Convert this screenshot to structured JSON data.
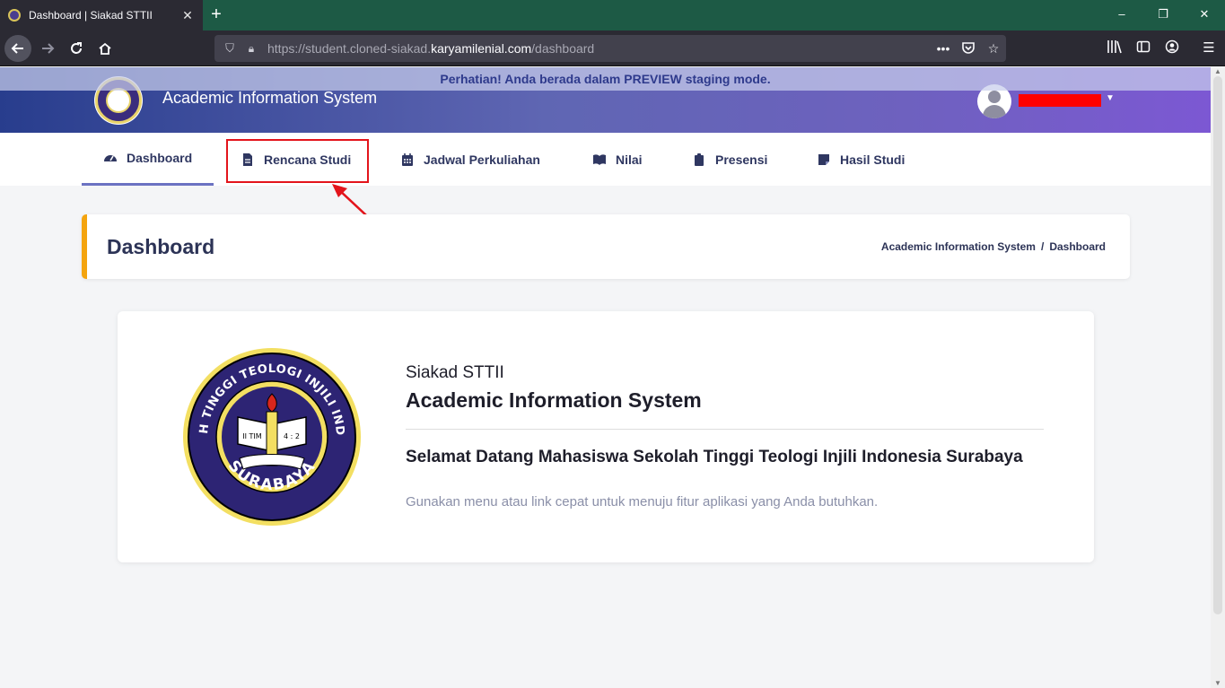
{
  "browser": {
    "tab_title": "Dashboard | Siakad STTII",
    "tab_close": "✕",
    "new_tab": "+",
    "url_prefix": "https://student.cloned-siakad.",
    "url_domain": "karyamilenial.com",
    "url_path": "/dashboard",
    "window_controls": {
      "minimize": "–",
      "restore": "❐",
      "close": "✕"
    }
  },
  "page": {
    "preview_notice": "Perhatian! Anda berada dalam PREVIEW staging mode.",
    "app_title": "Academic Information System",
    "menu": [
      {
        "label": "Dashboard",
        "icon": "dashboard-gauge-icon"
      },
      {
        "label": "Rencana Studi",
        "icon": "document-icon"
      },
      {
        "label": "Jadwal Perkuliahan",
        "icon": "calendar-icon"
      },
      {
        "label": "Nilai",
        "icon": "book-icon"
      },
      {
        "label": "Presensi",
        "icon": "clipboard-icon"
      },
      {
        "label": "Hasil Studi",
        "icon": "note-icon"
      }
    ],
    "page_title": "Dashboard",
    "breadcrumb": {
      "root": "Academic Information System",
      "sep": "/",
      "current": "Dashboard"
    },
    "card": {
      "subtitle": "Siakad STTII",
      "heading": "Academic Information System",
      "welcome": "Selamat Datang Mahasiswa Sekolah Tinggi Teologi Injili Indonesia Surabaya",
      "hint": "Gunakan menu atau link cepat untuk menuju fitur aplikasi yang Anda butuhkan.",
      "emblem_text_top": "SEKOLAH TINGGI TEOLOGI INJILI INDONESIA",
      "emblem_text_bottom": "SURABAYA",
      "emblem_verse_left": "II TIM",
      "emblem_verse_right": "4 : 2"
    }
  },
  "colors": {
    "accent": "#f4a40e",
    "brand_dark": "#283d8d",
    "brand_purple": "#7c58d3",
    "annotation_red": "#e3141b"
  }
}
